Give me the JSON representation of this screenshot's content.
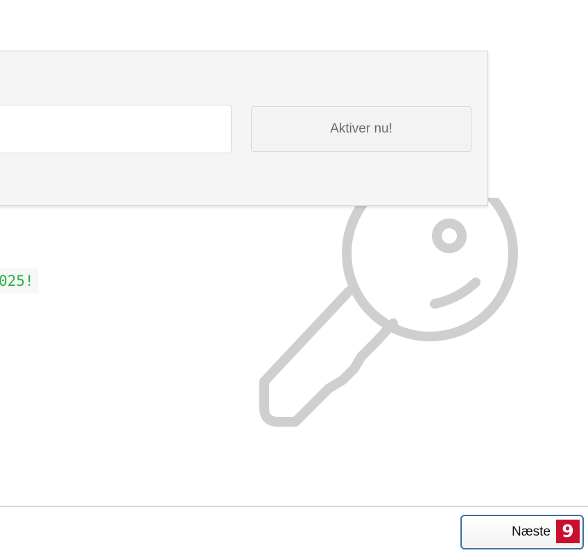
{
  "activation": {
    "input_value": "",
    "input_placeholder": "",
    "button_label": "Aktiver nu!"
  },
  "promo": {
    "text": "025!"
  },
  "footer": {
    "next_label": "Næste",
    "step_badge": "9"
  },
  "colors": {
    "promo_text": "#22b24c",
    "key_icon": "#cfcfcf",
    "badge": "#c8102e",
    "next_border": "#3b6fa0"
  },
  "icons": {
    "background": "key-icon"
  }
}
